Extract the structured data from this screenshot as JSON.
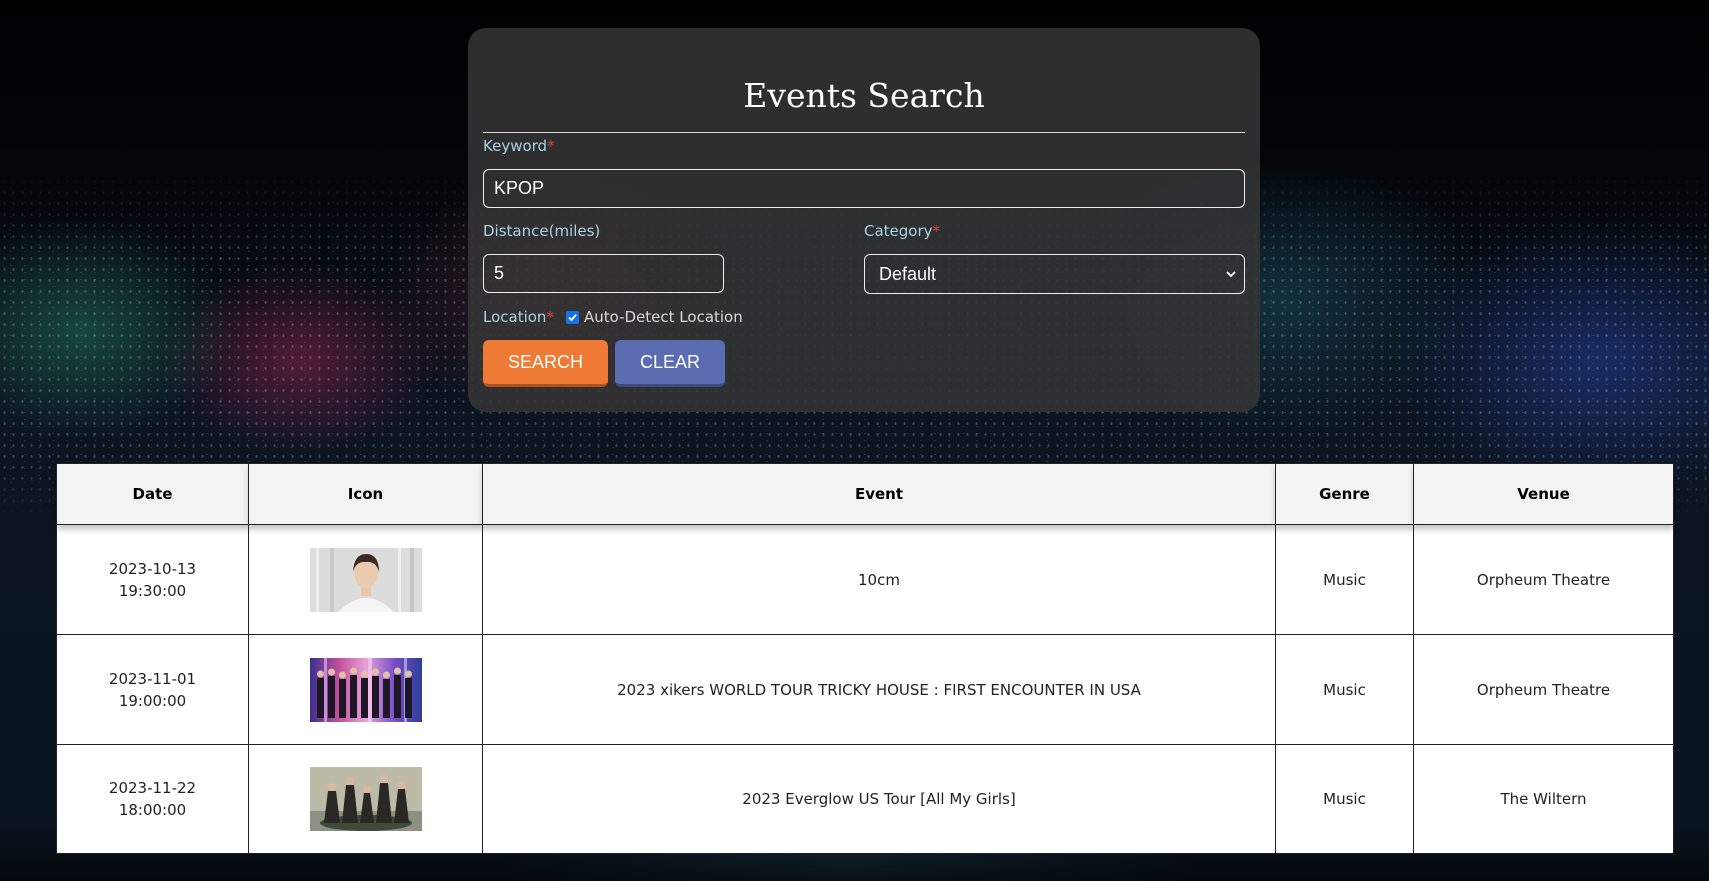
{
  "form": {
    "title": "Events Search",
    "keyword": {
      "label": "Keyword",
      "required_mark": "*",
      "value": "KPOP"
    },
    "distance": {
      "label": "Distance(miles)",
      "value": "5"
    },
    "category": {
      "label": "Category",
      "required_mark": "*",
      "selected": "Default"
    },
    "location": {
      "label": "Location",
      "required_mark": "*",
      "auto_detect_label": "Auto-Detect Location",
      "auto_detect_checked": true
    },
    "search_button": "SEARCH",
    "clear_button": "CLEAR"
  },
  "results": {
    "columns": [
      "Date",
      "Icon",
      "Event",
      "Genre",
      "Venue"
    ],
    "rows": [
      {
        "date": "2023-10-13",
        "time": "19:30:00",
        "icon": "portrait-thumbnail",
        "event": "10cm",
        "genre": "Music",
        "venue": "Orpheum Theatre"
      },
      {
        "date": "2023-11-01",
        "time": "19:00:00",
        "icon": "group-thumbnail",
        "event": "2023 xikers WORLD TOUR TRICKY HOUSE : FIRST ENCOUNTER IN USA",
        "genre": "Music",
        "venue": "Orpheum Theatre"
      },
      {
        "date": "2023-11-22",
        "time": "18:00:00",
        "icon": "group-thumbnail",
        "event": "2023 Everglow US Tour [All My Girls]",
        "genre": "Music",
        "venue": "The Wiltern"
      }
    ]
  },
  "colors": {
    "panel_bg": "#343434",
    "label": "#a9d2e7",
    "required": "#e0453c",
    "search_button": "#ef7a35",
    "clear_button": "#5b6db0",
    "checkbox": "#1773e6"
  }
}
